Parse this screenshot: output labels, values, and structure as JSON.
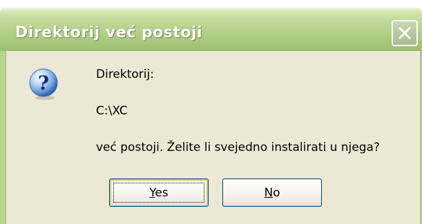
{
  "dialog": {
    "title": "Direktorij već postoji",
    "close_glyph": "✕",
    "icon": "question-icon",
    "message_line1": "Direktorij:",
    "message_line2": "C:\\XC",
    "message_line3": "već postoji. Želite li svejedno instalirati u njega?",
    "buttons": {
      "yes": {
        "mnemonic": "Y",
        "rest": "es"
      },
      "no": {
        "mnemonic": "N",
        "rest": "o"
      }
    }
  },
  "colors": {
    "titlebar": "#b2cf86",
    "client": "#ebe9d6",
    "button_border": "#003c74"
  }
}
